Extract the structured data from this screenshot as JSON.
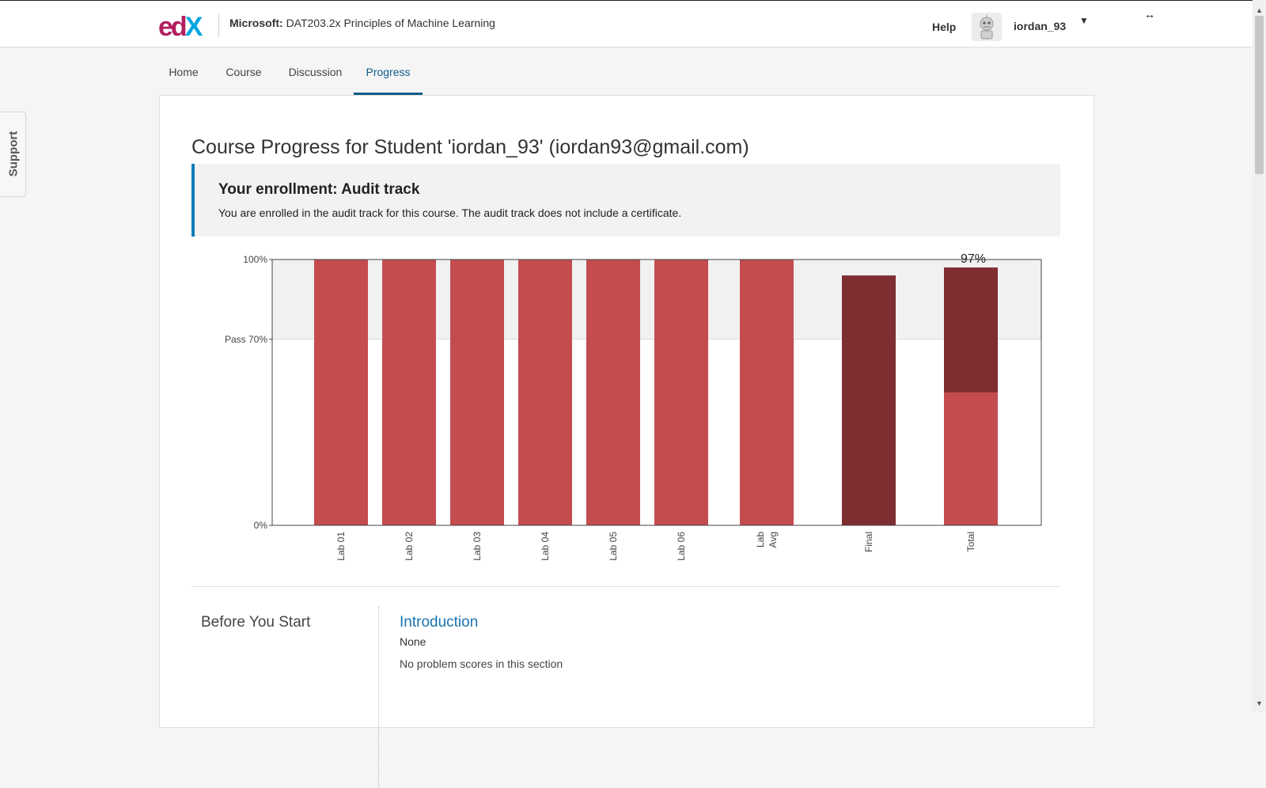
{
  "header": {
    "logo_text": [
      "e",
      "d",
      "X"
    ],
    "course_org": "Microsoft:",
    "course_name": "DAT203.2x Principles of Machine Learning",
    "help_label": "Help",
    "username": "iordan_93"
  },
  "nav": {
    "tabs": [
      {
        "label": "Home",
        "active": false
      },
      {
        "label": "Course",
        "active": false
      },
      {
        "label": "Discussion",
        "active": false
      },
      {
        "label": "Progress",
        "active": true
      }
    ]
  },
  "support_label": "Support",
  "page_title": "Course Progress for Student 'iordan_93' (iordan93@gmail.com)",
  "enrollment": {
    "title": "Your enrollment: Audit track",
    "message": "You are enrolled in the audit track for this course. The audit track does not include a certificate."
  },
  "colors": {
    "accent": "#0e5c8a",
    "bar": "#c44c4f",
    "bar_dark": "#7e2d31",
    "pass_band": "#f1f1f1"
  },
  "chart_data": {
    "type": "bar",
    "categories": [
      "Lab 01",
      "Lab 02",
      "Lab 03",
      "Lab 04",
      "Lab 05",
      "Lab 06",
      "Lab Avg",
      "Final",
      "Total"
    ],
    "category_lines": [
      [
        "Lab 01"
      ],
      [
        "Lab 02"
      ],
      [
        "Lab 03"
      ],
      [
        "Lab 04"
      ],
      [
        "Lab 05"
      ],
      [
        "Lab 06"
      ],
      [
        "Lab",
        "Avg"
      ],
      [
        "Final"
      ],
      [
        "Total"
      ]
    ],
    "values": [
      100,
      100,
      100,
      100,
      100,
      100,
      100,
      94,
      97
    ],
    "total_breakdown": [
      {
        "part": "Lab Avg",
        "value": 50
      },
      {
        "part": "Final",
        "value": 47
      }
    ],
    "total_label": "97%",
    "y_ticks": [
      {
        "value": 0,
        "label": "0%"
      },
      {
        "value": 70,
        "label": "Pass 70%"
      },
      {
        "value": 100,
        "label": "100%"
      }
    ],
    "ylim": [
      0,
      100
    ],
    "pass_mark": 70,
    "title": "",
    "xlabel": "",
    "ylabel": "",
    "grid": false
  },
  "section": {
    "title": "Before You Start",
    "subsection_link": "Introduction",
    "score": "None",
    "note": "No problem scores in this section"
  }
}
